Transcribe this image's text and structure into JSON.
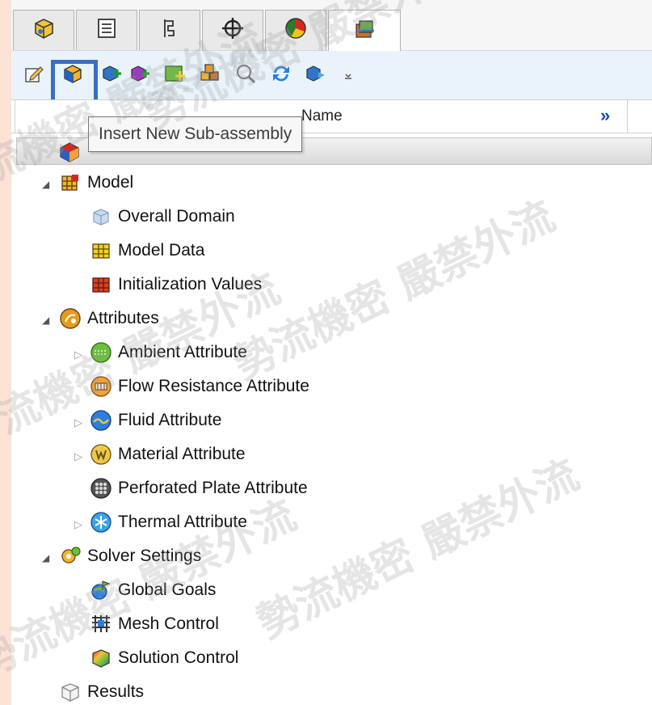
{
  "toolbar": {
    "tooltip": "Insert New Sub-assembly",
    "buttons": [
      {
        "icon": "edit-properties-icon"
      },
      {
        "icon": "insert-sub-assembly-icon"
      },
      {
        "icon": "insert-part-icon"
      },
      {
        "icon": "insert-assembly-icon"
      },
      {
        "icon": "add-object-icon"
      },
      {
        "icon": "component-group-icon"
      },
      {
        "icon": "zoom-icon"
      },
      {
        "icon": "refresh-icon"
      },
      {
        "icon": "compare-icon"
      },
      {
        "icon": "dropdown-arrow-icon"
      }
    ]
  },
  "tabs": [
    {
      "icon": "part-icon"
    },
    {
      "icon": "property-list-icon"
    },
    {
      "icon": "configuration-icon"
    },
    {
      "icon": "crosshair-icon"
    },
    {
      "icon": "display-pie-icon"
    },
    {
      "icon": "flow-simulation-icon",
      "active": true
    }
  ],
  "header": {
    "column_name": "Name",
    "more_icon": "»"
  },
  "tree": {
    "model": {
      "label": "Model",
      "icon": "model-icon"
    },
    "model_items": [
      {
        "label": "Overall Domain",
        "icon": "domain-icon"
      },
      {
        "label": "Model Data",
        "icon": "model-data-icon"
      },
      {
        "label": "Initialization Values",
        "icon": "initialization-icon"
      }
    ],
    "attributes": {
      "label": "Attributes",
      "icon": "attributes-icon"
    },
    "attribute_items": [
      {
        "label": "Ambient Attribute",
        "icon": "ambient-icon",
        "expandable": true
      },
      {
        "label": "Flow Resistance Attribute",
        "icon": "flow-resistance-icon",
        "expandable": false
      },
      {
        "label": "Fluid Attribute",
        "icon": "fluid-icon",
        "expandable": true
      },
      {
        "label": "Material Attribute",
        "icon": "material-icon",
        "expandable": true
      },
      {
        "label": "Perforated Plate Attribute",
        "icon": "perforated-plate-icon",
        "expandable": false
      },
      {
        "label": "Thermal Attribute",
        "icon": "thermal-icon",
        "expandable": true
      }
    ],
    "solver": {
      "label": "Solver Settings",
      "icon": "solver-settings-icon"
    },
    "solver_items": [
      {
        "label": "Global Goals",
        "icon": "global-goals-icon"
      },
      {
        "label": "Mesh Control",
        "icon": "mesh-control-icon"
      },
      {
        "label": "Solution Control",
        "icon": "solution-control-icon"
      }
    ],
    "results": {
      "label": "Results",
      "icon": "results-icon"
    }
  },
  "watermark": {
    "text": "勢流機密 嚴禁外流"
  },
  "colors": {
    "background": "#fce3d6",
    "toolbar": "#eaf3fb",
    "highlight": "#3a6ec3",
    "chevron": "#1a4fb3"
  }
}
